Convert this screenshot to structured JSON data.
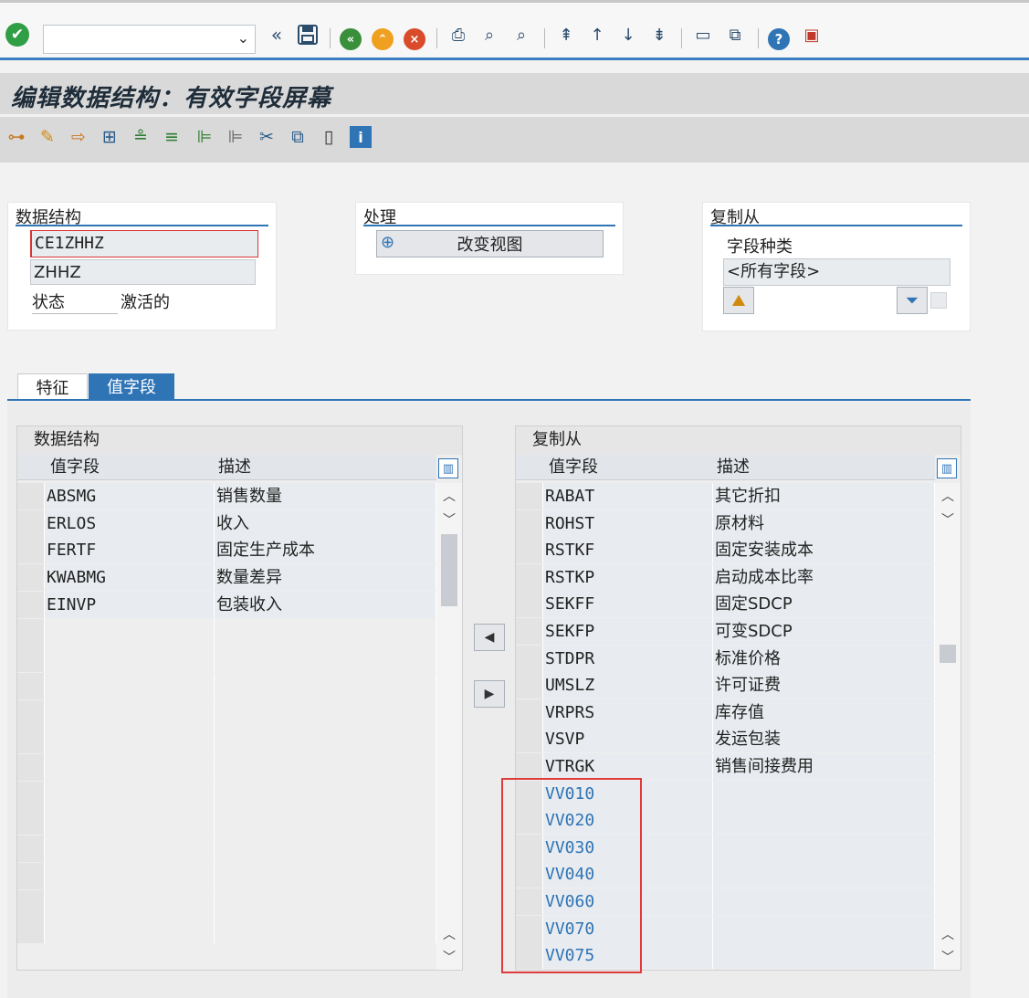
{
  "toolbar": {
    "command_value": "",
    "icons": [
      "check-icon",
      "dropdown-icon",
      "back-double-icon",
      "save-icon",
      "back-icon",
      "exit-icon",
      "cancel-icon",
      "print-icon",
      "find-icon",
      "find-next-icon",
      "first-page-icon",
      "prev-page-icon",
      "next-page-icon",
      "last-page-icon",
      "new-session-icon",
      "shortcut-icon",
      "help-icon",
      "layout-icon"
    ]
  },
  "title": "编辑数据结构：有效字段屏幕",
  "app_toolbar": {
    "icons": [
      "hierarchy-icon",
      "wizard-icon",
      "transfer-icon",
      "select-icon",
      "align-icon",
      "filter-list-icon",
      "export-icon",
      "import-icon",
      "cut-icon",
      "copy-icon",
      "blank-page-icon",
      "info-icon"
    ]
  },
  "data_structure_group": {
    "heading": "数据结构",
    "name": "CE1ZHHZ",
    "description": "ZHHZ",
    "status_label": "状态",
    "status_value": "激活的"
  },
  "processing_group": {
    "heading": "处理",
    "change_view_label": "改变视图"
  },
  "copy_from_group": {
    "heading": "复制从",
    "field_type_label": "字段种类",
    "field_type_value": "<所有字段>"
  },
  "tabs": [
    {
      "label": "特征",
      "active": false
    },
    {
      "label": "值字段",
      "active": true
    }
  ],
  "left_table": {
    "caption": "数据结构",
    "col_field": "值字段",
    "col_desc": "描述",
    "rows": [
      {
        "field": "ABSMG",
        "desc": "销售数量"
      },
      {
        "field": "ERLOS",
        "desc": "收入"
      },
      {
        "field": "FERTF",
        "desc": "固定生产成本"
      },
      {
        "field": "KWABMG",
        "desc": "数量差异"
      },
      {
        "field": "EINVP",
        "desc": "包装收入"
      },
      {
        "field": "",
        "desc": ""
      },
      {
        "field": "",
        "desc": ""
      },
      {
        "field": "",
        "desc": ""
      },
      {
        "field": "",
        "desc": ""
      },
      {
        "field": "",
        "desc": ""
      },
      {
        "field": "",
        "desc": ""
      },
      {
        "field": "",
        "desc": ""
      },
      {
        "field": "",
        "desc": ""
      },
      {
        "field": "",
        "desc": ""
      },
      {
        "field": "",
        "desc": ""
      },
      {
        "field": "",
        "desc": ""
      },
      {
        "field": "",
        "desc": ""
      }
    ]
  },
  "right_table": {
    "caption": "复制从",
    "col_field": "值字段",
    "col_desc": "描述",
    "rows": [
      {
        "field": "RABAT",
        "desc": "其它折扣"
      },
      {
        "field": "ROHST",
        "desc": "原材料"
      },
      {
        "field": "RSTKF",
        "desc": "固定安装成本"
      },
      {
        "field": "RSTKP",
        "desc": "启动成本比率"
      },
      {
        "field": "SEKFF",
        "desc": "固定SDCP"
      },
      {
        "field": "SEKFP",
        "desc": "可变SDCP"
      },
      {
        "field": "STDPR",
        "desc": "标准价格"
      },
      {
        "field": "UMSLZ",
        "desc": "许可证费"
      },
      {
        "field": "VRPRS",
        "desc": "库存值"
      },
      {
        "field": "VSVP",
        "desc": "发运包装"
      },
      {
        "field": "VTRGK",
        "desc": "销售间接费用"
      },
      {
        "field": "VV010",
        "desc": ""
      },
      {
        "field": "VV020",
        "desc": ""
      },
      {
        "field": "VV030",
        "desc": ""
      },
      {
        "field": "VV040",
        "desc": ""
      },
      {
        "field": "VV060",
        "desc": ""
      },
      {
        "field": "VV070",
        "desc": ""
      },
      {
        "field": "VV075",
        "desc": ""
      }
    ]
  },
  "colors": {
    "accent": "#2f74b5",
    "highlight_box": "#e03b3b",
    "new_field_text": "#2f74b5"
  }
}
